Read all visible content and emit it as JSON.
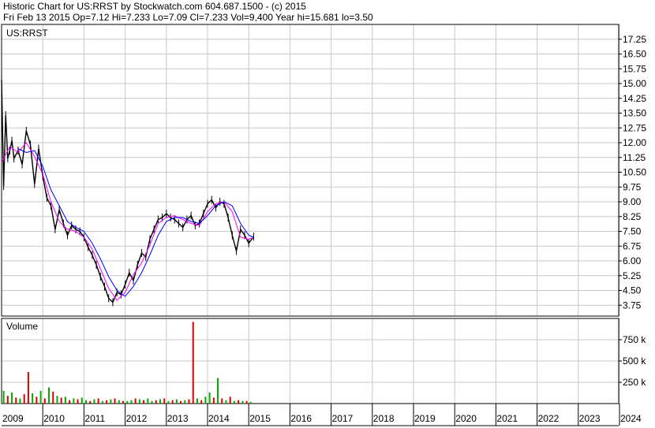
{
  "header": {
    "line1": "Historic Chart for US:RRST by Stockwatch.com 604.687.1500 - (c) 2015",
    "line2": "Fri Feb 13 2015   Op=7.12  Hi=7.233  Lo=7.09  Cl=7.233  Vol=9,400  Year hi=15.681  lo=3.50"
  },
  "chart_data": [
    {
      "type": "line",
      "title": "US:RRST",
      "y_ticks": [
        "17.25",
        "16.50",
        "15.75",
        "15.00",
        "14.25",
        "13.50",
        "12.75",
        "12.00",
        "11.25",
        "10.50",
        "9.75",
        "9.00",
        "8.25",
        "7.50",
        "6.75",
        "6.00",
        "5.25",
        "4.50",
        "3.75"
      ],
      "ylim": [
        3.2,
        18.0
      ],
      "x_ticks": [
        "2009",
        "2010",
        "2011",
        "2012",
        "2013",
        "2014",
        "2015",
        "2016",
        "2017",
        "2018",
        "2019",
        "2020",
        "2021",
        "2022",
        "2023",
        "2024"
      ],
      "grid": true,
      "series": [
        {
          "color": "#000000",
          "x": [
            2009.0,
            2009.05,
            2009.1,
            2009.15,
            2009.2,
            2009.25,
            2009.3,
            2009.4,
            2009.5,
            2009.6,
            2009.7,
            2009.8,
            2009.9,
            2010.0,
            2010.1,
            2010.2,
            2010.3,
            2010.4,
            2010.5,
            2010.6,
            2010.7,
            2010.8,
            2010.9,
            2011.0,
            2011.1,
            2011.2,
            2011.3,
            2011.4,
            2011.5,
            2011.6,
            2011.7,
            2011.8,
            2011.9,
            2012.0,
            2012.1,
            2012.2,
            2012.3,
            2012.4,
            2012.5,
            2012.6,
            2012.7,
            2012.8,
            2012.9,
            2013.0,
            2013.1,
            2013.2,
            2013.3,
            2013.4,
            2013.5,
            2013.6,
            2013.7,
            2013.8,
            2013.9,
            2014.0,
            2014.1,
            2014.2,
            2014.3,
            2014.4,
            2014.5,
            2014.6,
            2014.7,
            2014.8,
            2014.9,
            2015.0,
            2015.12
          ],
          "y": [
            15.2,
            9.8,
            13.4,
            11.2,
            11.6,
            12.1,
            11.2,
            11.6,
            10.9,
            12.6,
            11.9,
            9.9,
            11.7,
            10.3,
            9.2,
            8.8,
            7.6,
            8.6,
            7.9,
            7.3,
            7.8,
            7.6,
            7.5,
            7.2,
            6.7,
            6.3,
            5.8,
            5.2,
            4.7,
            4.1,
            3.9,
            4.4,
            4.3,
            4.8,
            5.4,
            5.0,
            5.8,
            6.4,
            6.2,
            7.1,
            7.6,
            8.1,
            8.2,
            8.4,
            8.2,
            8.1,
            7.9,
            7.7,
            8.1,
            8.3,
            7.8,
            7.9,
            8.4,
            8.9,
            9.1,
            8.7,
            9.0,
            8.9,
            8.2,
            7.3,
            6.5,
            7.6,
            7.3,
            6.9,
            7.233
          ]
        },
        {
          "color": "#ff00ff",
          "x": [
            2009.0,
            2009.2,
            2009.4,
            2009.6,
            2009.8,
            2010.0,
            2010.2,
            2010.4,
            2010.6,
            2010.8,
            2011.0,
            2011.2,
            2011.4,
            2011.6,
            2011.8,
            2012.0,
            2012.2,
            2012.4,
            2012.6,
            2012.8,
            2013.0,
            2013.2,
            2013.4,
            2013.6,
            2013.8,
            2014.0,
            2014.2,
            2014.4,
            2014.6,
            2014.8,
            2015.0,
            2015.12
          ],
          "y": [
            11.0,
            11.8,
            11.5,
            12.0,
            11.3,
            10.4,
            9.0,
            8.0,
            7.6,
            7.5,
            7.2,
            6.6,
            5.6,
            4.6,
            4.0,
            4.4,
            5.3,
            5.9,
            6.8,
            7.9,
            8.2,
            8.3,
            8.1,
            7.9,
            7.8,
            8.5,
            8.9,
            9.0,
            8.5,
            7.2,
            7.1,
            7.2
          ]
        },
        {
          "color": "#0000ff",
          "x": [
            2009.4,
            2009.6,
            2009.8,
            2010.0,
            2010.2,
            2010.4,
            2010.6,
            2010.8,
            2011.0,
            2011.2,
            2011.4,
            2011.6,
            2011.8,
            2012.0,
            2012.2,
            2012.4,
            2012.6,
            2012.8,
            2013.0,
            2013.2,
            2013.4,
            2013.6,
            2013.8,
            2014.0,
            2014.2,
            2014.4,
            2014.6,
            2014.8,
            2015.0,
            2015.12
          ],
          "y": [
            11.7,
            11.5,
            11.6,
            10.8,
            9.6,
            8.8,
            8.0,
            7.7,
            7.5,
            6.9,
            6.1,
            5.2,
            4.5,
            4.2,
            4.7,
            5.4,
            6.3,
            7.3,
            8.0,
            8.2,
            8.2,
            8.0,
            7.9,
            8.3,
            8.8,
            9.0,
            8.8,
            7.9,
            7.3,
            7.2
          ]
        }
      ]
    },
    {
      "type": "bar",
      "title": "Volume",
      "y_ticks": [
        "750 k",
        "500 k",
        "250 k"
      ],
      "ylim": [
        0,
        1000
      ],
      "x_ticks": [
        "2009",
        "2010",
        "2011",
        "2012",
        "2013",
        "2014",
        "2015",
        "2016",
        "2017",
        "2018",
        "2019",
        "2020",
        "2021",
        "2022",
        "2023",
        "2024"
      ],
      "grid": true,
      "up_color": "#00aa00",
      "down_color": "#dd0000",
      "x": [
        2009.05,
        2009.15,
        2009.25,
        2009.35,
        2009.45,
        2009.55,
        2009.65,
        2009.75,
        2009.85,
        2009.95,
        2010.05,
        2010.15,
        2010.25,
        2010.35,
        2010.45,
        2010.55,
        2010.65,
        2010.75,
        2010.85,
        2010.95,
        2011.05,
        2011.15,
        2011.25,
        2011.35,
        2011.45,
        2011.55,
        2011.65,
        2011.75,
        2011.85,
        2011.95,
        2012.05,
        2012.15,
        2012.25,
        2012.35,
        2012.45,
        2012.55,
        2012.65,
        2012.75,
        2012.85,
        2012.95,
        2013.05,
        2013.15,
        2013.25,
        2013.35,
        2013.45,
        2013.55,
        2013.65,
        2013.75,
        2013.85,
        2013.95,
        2014.05,
        2014.15,
        2014.25,
        2014.35,
        2014.45,
        2014.55,
        2014.65,
        2014.75,
        2014.85,
        2014.95,
        2015.05
      ],
      "values": [
        150,
        90,
        130,
        70,
        60,
        110,
        370,
        120,
        80,
        150,
        60,
        190,
        140,
        90,
        70,
        80,
        40,
        60,
        50,
        70,
        40,
        30,
        50,
        60,
        30,
        40,
        50,
        60,
        40,
        30,
        30,
        40,
        60,
        50,
        40,
        60,
        30,
        40,
        50,
        60,
        30,
        40,
        50,
        30,
        40,
        50,
        960,
        60,
        40,
        80,
        130,
        70,
        300,
        60,
        40,
        80,
        30,
        40,
        30,
        30,
        20
      ],
      "up": [
        true,
        false,
        true,
        false,
        true,
        false,
        false,
        true,
        false,
        true,
        false,
        true,
        false,
        true,
        false,
        true,
        false,
        true,
        false,
        true,
        true,
        false,
        true,
        false,
        true,
        false,
        true,
        false,
        true,
        false,
        true,
        true,
        false,
        true,
        false,
        true,
        true,
        false,
        true,
        false,
        true,
        false,
        true,
        false,
        true,
        false,
        false,
        true,
        false,
        true,
        true,
        false,
        true,
        false,
        true,
        false,
        true,
        false,
        true,
        false,
        true
      ]
    }
  ]
}
